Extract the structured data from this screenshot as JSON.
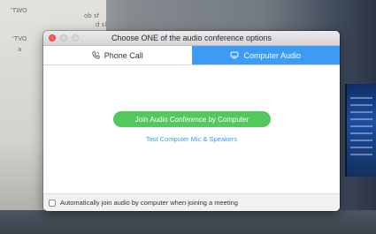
{
  "background_scene": {
    "scribbles": [
      "'TWO",
      "ob sf",
      "'TVO",
      "d sl",
      "a"
    ]
  },
  "window": {
    "title": "Choose ONE of the audio conference options",
    "controls": [
      "close",
      "minimize",
      "maximize"
    ]
  },
  "tabs": [
    {
      "label": "Phone Call",
      "icon": "phone-icon",
      "selected": false
    },
    {
      "label": "Computer Audio",
      "icon": "monitor-icon",
      "selected": true
    }
  ],
  "main": {
    "join_button_label": "Join Audio Conference by Computer",
    "test_link_label": "Test Computer Mic & Speakers"
  },
  "footer": {
    "auto_join_label": "Automatically join audio by computer when joining a meeting",
    "auto_join_checked": false
  },
  "colors": {
    "accent_blue": "#3c9bf5",
    "join_green": "#53c95d",
    "close_red": "#fc605c"
  }
}
